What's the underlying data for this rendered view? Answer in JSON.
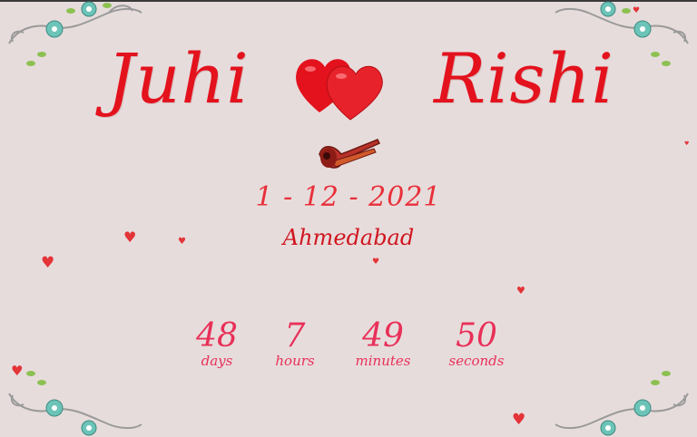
{
  "couple": {
    "bride": "Juhi",
    "groom": "Rishi"
  },
  "event": {
    "date": "1 - 12 - 2021",
    "city": "Ahmedabad"
  },
  "countdown": [
    {
      "value": "48",
      "label": "days"
    },
    {
      "value": "7",
      "label": "hours"
    },
    {
      "value": "49",
      "label": "minutes"
    },
    {
      "value": "50",
      "label": "seconds"
    }
  ],
  "icons": [
    "double-heart-icon",
    "shehnai-horn-icon",
    "floral-corner-icon",
    "floating-heart-icon"
  ],
  "colors": {
    "accent": "#e3121d",
    "countdown": "#e83058",
    "background": "#e7dcdc"
  }
}
